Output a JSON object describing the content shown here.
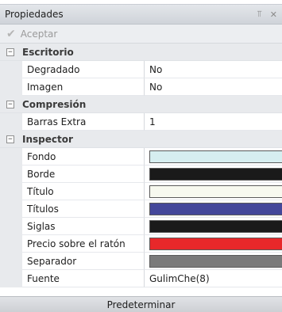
{
  "panel": {
    "title": "Propiedades",
    "pin_icon": "pin-icon",
    "close_icon": "close-icon"
  },
  "toolbar": {
    "accept_label": "Aceptar",
    "accept_icon": "checkmark-icon"
  },
  "categories": [
    {
      "label": "Escritorio",
      "expanded": true,
      "properties": [
        {
          "name": "Degradado",
          "value": "No"
        },
        {
          "name": "Imagen",
          "value": "No"
        }
      ]
    },
    {
      "label": "Compresión",
      "expanded": true,
      "properties": [
        {
          "name": "Barras Extra",
          "value": "1"
        }
      ]
    },
    {
      "label": "Inspector",
      "expanded": true,
      "properties": [
        {
          "name": "Fondo",
          "color": "#d6eef0"
        },
        {
          "name": "Borde",
          "color": "#1a1a1a"
        },
        {
          "name": "Título",
          "color": "#f7f9ef"
        },
        {
          "name": "Títulos",
          "color": "#44479a"
        },
        {
          "name": "Siglas",
          "color": "#1a1a1a"
        },
        {
          "name": "Precio sobre el ratón",
          "color": "#e8282a"
        },
        {
          "name": "Separador",
          "color": "#7a7a7a"
        },
        {
          "name": "Fuente",
          "value": "GulimChe(8)"
        }
      ]
    }
  ],
  "footer": {
    "button_label": "Predeterminar"
  },
  "toggle_symbol": "⊟"
}
